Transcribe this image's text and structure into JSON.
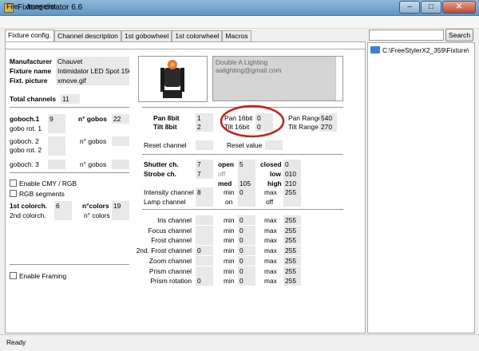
{
  "window": {
    "title": "Fixture creator 6.6",
    "close_symbol": "✕",
    "min_symbol": "–",
    "max_symbol": "□"
  },
  "menu": [
    "File",
    "Imagelist"
  ],
  "tabs": [
    "Fixture config.",
    "Channel description",
    "1st gobowheel",
    "1st colorwheel",
    "Macros"
  ],
  "search": {
    "button": "Search"
  },
  "tree": {
    "folder": "C:\\FreeStylerX2_359\\Fixture\\"
  },
  "fixture": {
    "manufacturer_label": "Manufacturer",
    "manufacturer": "Chauvet",
    "name_label": "Fixture name",
    "name": "Intimidator LED Spot 150 (",
    "picture_label": "Fixt. picture",
    "picture": "xmove.gif",
    "total_label": "Total channels",
    "total": "11",
    "notes_line1": "Double A Lighting",
    "notes_line2": "aalighting@gmail.com"
  },
  "gobo": {
    "goboch1": "goboch.1",
    "goboch1_val": "9",
    "gobo_rot1": "gobo rot. 1",
    "ngobos_b": "n° gobos",
    "ngobos_b_val": "22",
    "goboch2": "goboch. 2",
    "gobo_rot2": "gobo rot. 2",
    "ngobos2": "n° gobos",
    "goboch3": "goboch. 3",
    "ngobos3": "n° gobos"
  },
  "color": {
    "enable_cmy": "Enable CMY / RGB",
    "rgb_segments": "RGB segments",
    "colorch1": "1st colorch.",
    "colorch1_val": "6",
    "ncolors_b": "n°colors",
    "ncolors_b_val": "19",
    "colorch2": "2nd colorch.",
    "ncolors": "n° colors",
    "enable_framing": "Enable Framing"
  },
  "pan": {
    "pan8": "Pan 8bit",
    "pan8_val": "1",
    "tilt8": "Tilt 8bit",
    "tilt8_val": "2",
    "pan16": "Pan 16bit",
    "pan16_val": "0",
    "tilt16": "Tilt 16bit",
    "tilt16_val": "0",
    "pan_range": "Pan Range",
    "pan_range_val": "540",
    "tilt_range": "Tilt Range",
    "tilt_range_val": "270",
    "reset_channel": "Reset channel",
    "reset_value": "Reset value"
  },
  "shutter": {
    "shutter": "Shutter ch.",
    "shutter_val": "7",
    "strobe": "Strobe ch.",
    "strobe_val": "7",
    "open": "open",
    "open_val": "5",
    "closed": "closed",
    "closed_val": "0",
    "off": "off",
    "low": "low",
    "low_val": "010",
    "med": "med",
    "med_val": "105",
    "high": "high",
    "high_val": "210",
    "intensity": "Intensity channel",
    "intensity_val": "8",
    "min": "min",
    "intensity_min": "0",
    "max": "max",
    "intensity_max": "255",
    "lamp": "Lamp channel",
    "on": "on",
    "off2": "off"
  },
  "channels": [
    {
      "name": "Iris channel",
      "val": "",
      "min": "0",
      "max": "255"
    },
    {
      "name": "Focus channel",
      "val": "",
      "min": "0",
      "max": "255"
    },
    {
      "name": "Frost channel",
      "val": "",
      "min": "0",
      "max": "255"
    },
    {
      "name": "2nd. Frost channel",
      "val": "0",
      "min": "0",
      "max": "255"
    },
    {
      "name": "Zoom channel",
      "val": "",
      "min": "0",
      "max": "255"
    },
    {
      "name": "Prism channel",
      "val": "",
      "min": "0",
      "max": "255"
    },
    {
      "name": "Prism rotation",
      "val": "0",
      "min": "0",
      "max": "255"
    }
  ],
  "status": "Ready"
}
